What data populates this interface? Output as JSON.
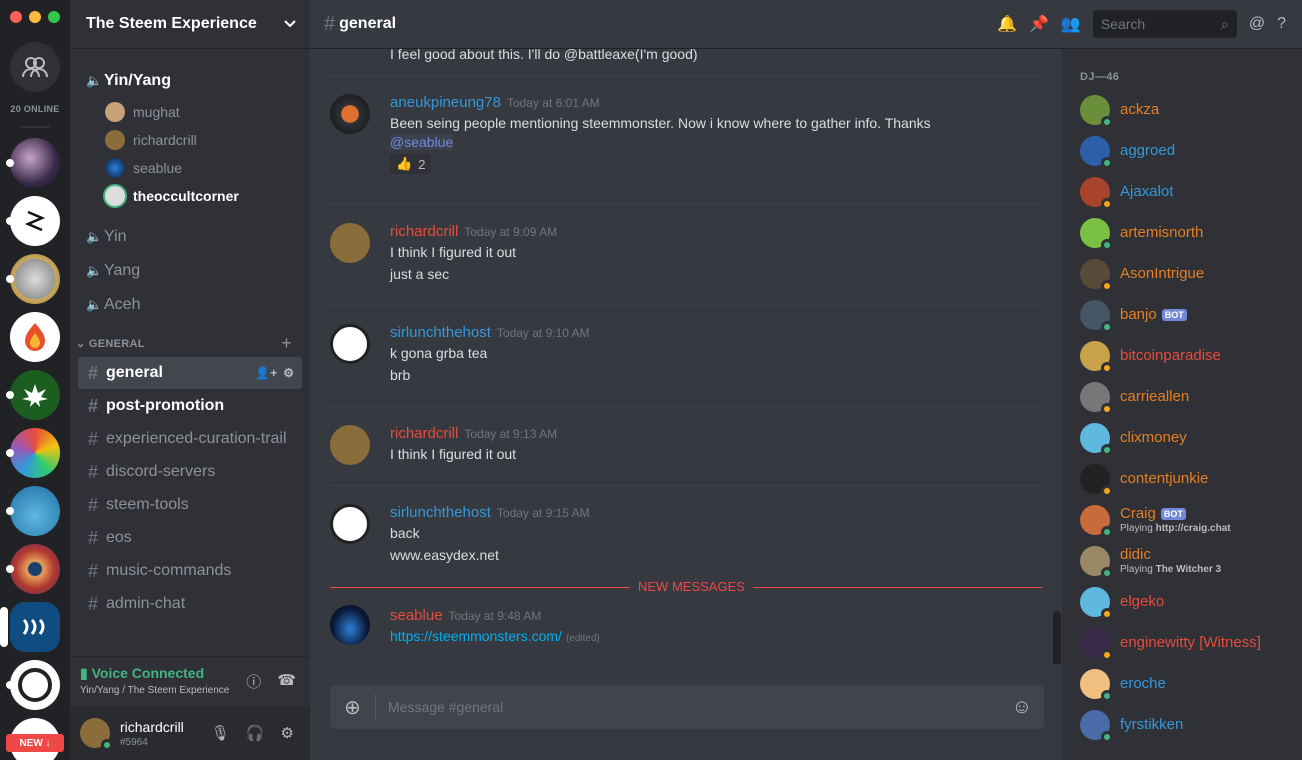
{
  "colors": {
    "online": "#43b581",
    "idle": "#faa61a",
    "orange": "#e67e22",
    "blue": "#3498db",
    "red": "#e74c3c"
  },
  "rail": {
    "online_count": "20 ONLINE",
    "new_badge": "NEW ↓"
  },
  "server": {
    "name": "The Steem Experience"
  },
  "voice": {
    "active_channel": "Yin/Yang",
    "users": [
      "mughat",
      "richardcrill",
      "seablue",
      "theoccultcorner"
    ],
    "other_channels": [
      "Yin",
      "Yang",
      "Aceh"
    ]
  },
  "category": {
    "name": "GENERAL"
  },
  "channels": [
    "general",
    "post-promotion",
    "experienced-curation-trail",
    "discord-servers",
    "steem-tools",
    "eos",
    "music-commands",
    "admin-chat"
  ],
  "voice_panel": {
    "status": "Voice Connected",
    "where": "Yin/Yang / The Steem Experience"
  },
  "user_panel": {
    "name": "richardcrill",
    "tag": "#5964"
  },
  "topbar": {
    "channel": "general",
    "search_placeholder": "Search"
  },
  "messages": [
    {
      "partial": "I feel good about this. I'll do @battleaxe(I'm good)"
    },
    {
      "author": "aneukpineung78",
      "time": "Today at 6:01 AM",
      "lines": [
        "Been seing people mentioning steemmonster. Now i know where to gather info. Thanks"
      ],
      "mention": "@seablue",
      "reaction_count": "2"
    },
    {
      "author": "richardcrill",
      "time": "Today at 9:09 AM",
      "lines": [
        "I think I figured it out",
        "just a sec"
      ]
    },
    {
      "author": "sirlunchthehost",
      "time": "Today at 9:10 AM",
      "lines": [
        "k gona grba tea",
        "brb"
      ]
    },
    {
      "author": "richardcrill",
      "time": "Today at 9:13 AM",
      "lines": [
        "I think I figured it out"
      ]
    },
    {
      "author": "sirlunchthehost",
      "time": "Today at 9:15 AM",
      "lines": [
        "back",
        "www.easydex.net"
      ]
    },
    {
      "author": "seablue",
      "time": "Today at 9:48 AM",
      "link": "https://steemmonsters.com/",
      "edited": "(edited)"
    }
  ],
  "new_messages_label": "NEW MESSAGES",
  "composer": {
    "placeholder": "Message #general"
  },
  "members": {
    "role": "DJ—46",
    "list": [
      {
        "name": "ackza",
        "color": "#e67e22",
        "status": "online"
      },
      {
        "name": "aggroed",
        "color": "#3498db",
        "status": "online"
      },
      {
        "name": "Ajaxalot",
        "color": "#3498db",
        "status": "idle"
      },
      {
        "name": "artemisnorth",
        "color": "#e67e22",
        "status": "online"
      },
      {
        "name": "AsonIntrigue",
        "color": "#e67e22",
        "status": "idle"
      },
      {
        "name": "banjo",
        "color": "#e67e22",
        "status": "online",
        "bot": "BOT"
      },
      {
        "name": "bitcoinparadise",
        "color": "#e74c3c",
        "status": "idle"
      },
      {
        "name": "carrieallen",
        "color": "#e67e22",
        "status": "idle"
      },
      {
        "name": "clixmoney",
        "color": "#e67e22",
        "status": "online"
      },
      {
        "name": "contentjunkie",
        "color": "#e67e22",
        "status": "idle"
      },
      {
        "name": "Craig",
        "color": "#e67e22",
        "status": "online",
        "bot": "BOT",
        "activity_prefix": "Playing",
        "activity": "http://craig.chat"
      },
      {
        "name": "didic",
        "color": "#e67e22",
        "status": "online",
        "activity_prefix": "Playing",
        "activity": "The Witcher 3"
      },
      {
        "name": "elgeko",
        "color": "#e74c3c",
        "status": "idle"
      },
      {
        "name": "enginewitty [Witness]",
        "color": "#e74c3c",
        "status": "idle"
      },
      {
        "name": "eroche",
        "color": "#3498db",
        "status": "online"
      },
      {
        "name": "fyrstikken",
        "color": "#3498db",
        "status": "online"
      }
    ]
  }
}
